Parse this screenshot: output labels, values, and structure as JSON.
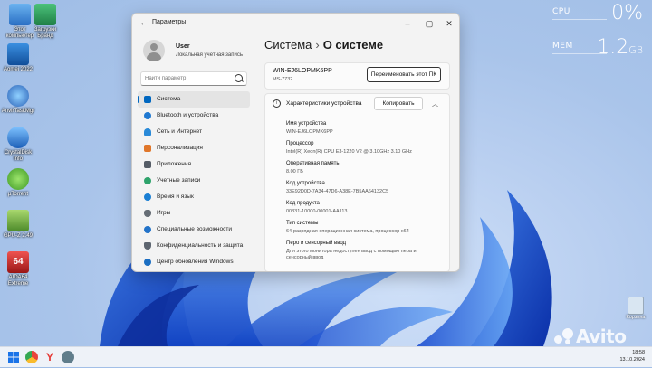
{
  "desktop": {
    "icons": [
      {
        "label": "Этот компьютер",
        "name": "this-pc-icon",
        "color": "#4a90d9"
      },
      {
        "label": "Загрузки Бранд",
        "name": "downloads-icon",
        "color": "#2e9d5b"
      },
      {
        "label": "Aomei 2022",
        "name": "aomei-icon",
        "color": "#1c6db3"
      },
      {
        "label": "AnvirTaskMgr",
        "name": "anvir-icon",
        "color": "#2a62b8"
      },
      {
        "label": "CrystalDisk Info",
        "name": "crystaldisk-icon",
        "color": "#3a7bd5"
      },
      {
        "label": "µTorrent",
        "name": "utorrent-icon",
        "color": "#5bb536"
      },
      {
        "label": "GPU-Z 2.49",
        "name": "gpuz-icon",
        "color": "#6bb04a"
      },
      {
        "label": "AIDA64 Extreme",
        "name": "aida64-icon",
        "color": "#c62828"
      }
    ],
    "recycle_bin": "Корзина"
  },
  "meters": {
    "cpu": {
      "label": "CPU",
      "value": "0%",
      "fill": 0.0
    },
    "mem": {
      "label": "MEM",
      "value": "1.2",
      "unit": "GB",
      "fill": 0.15
    }
  },
  "window": {
    "title": "Параметры",
    "back_icon": "back-arrow-icon",
    "controls": [
      "minimize",
      "maximize",
      "close"
    ],
    "user": {
      "name": "User",
      "type": "Локальная учетная запись"
    },
    "search_placeholder": "Найти параметр",
    "nav": [
      {
        "label": "Система",
        "active": true,
        "icon": "system-icon",
        "color": "#0067c0"
      },
      {
        "label": "Bluetooth и устройства",
        "active": false,
        "icon": "bluetooth-icon",
        "color": "#1f78d1"
      },
      {
        "label": "Сеть и Интернет",
        "active": false,
        "icon": "network-icon",
        "color": "#2a8ad8"
      },
      {
        "label": "Персонализация",
        "active": false,
        "icon": "personalization-icon",
        "color": "#e0772b"
      },
      {
        "label": "Приложения",
        "active": false,
        "icon": "apps-icon",
        "color": "#555c66"
      },
      {
        "label": "Учетные записи",
        "active": false,
        "icon": "accounts-icon",
        "color": "#2ea36b"
      },
      {
        "label": "Время и язык",
        "active": false,
        "icon": "time-language-icon",
        "color": "#1a7fd4"
      },
      {
        "label": "Игры",
        "active": false,
        "icon": "gaming-icon",
        "color": "#666d75"
      },
      {
        "label": "Специальные возможности",
        "active": false,
        "icon": "accessibility-icon",
        "color": "#2373c9"
      },
      {
        "label": "Конфиденциальность и защита",
        "active": false,
        "icon": "privacy-shield-icon",
        "color": "#5d6570"
      },
      {
        "label": "Центр обновления Windows",
        "active": false,
        "icon": "windows-update-icon",
        "color": "#1b6ec2"
      }
    ],
    "breadcrumb": {
      "parent": "Система",
      "separator": "›",
      "current": "О системе"
    },
    "device": {
      "name": "WIN-EJ6LOPMK6PP",
      "model": "MS-7732",
      "rename_button": "Переименовать этот ПК"
    },
    "specs": {
      "title": "Характеристики устройства",
      "copy_button": "Копировать",
      "rows": [
        {
          "key": "Имя устройства",
          "value": "WIN-EJ6LOPMK6PP"
        },
        {
          "key": "Процессор",
          "value": "Intel(R) Xeon(R) CPU E3-1220 V2 @ 3.10GHz   3.10 GHz"
        },
        {
          "key": "Оперативная память",
          "value": "8.00 ГБ"
        },
        {
          "key": "Код устройства",
          "value": "33E92D0D-7A34-47D6-A38E-7B5AA64132C5"
        },
        {
          "key": "Код продукта",
          "value": "00331-10000-00001-AA113"
        },
        {
          "key": "Тип системы",
          "value": "64-разрядная операционная система, процессор x64"
        },
        {
          "key": "Перо и сенсорный ввод",
          "value": "Для этого монитора недоступен ввод с помощью пера и сенсорный ввод"
        }
      ]
    }
  },
  "taskbar": {
    "apps": [
      {
        "name": "start-icon",
        "color": "#1a73e8"
      },
      {
        "name": "chrome-icon",
        "color": "#e8453c"
      },
      {
        "name": "yandex-browser-icon",
        "color": "#e53935"
      },
      {
        "name": "settings-gear-icon",
        "color": "#607d8b"
      }
    ],
    "time": "18:58",
    "date": "13.10.2024"
  },
  "watermark": "Avito"
}
